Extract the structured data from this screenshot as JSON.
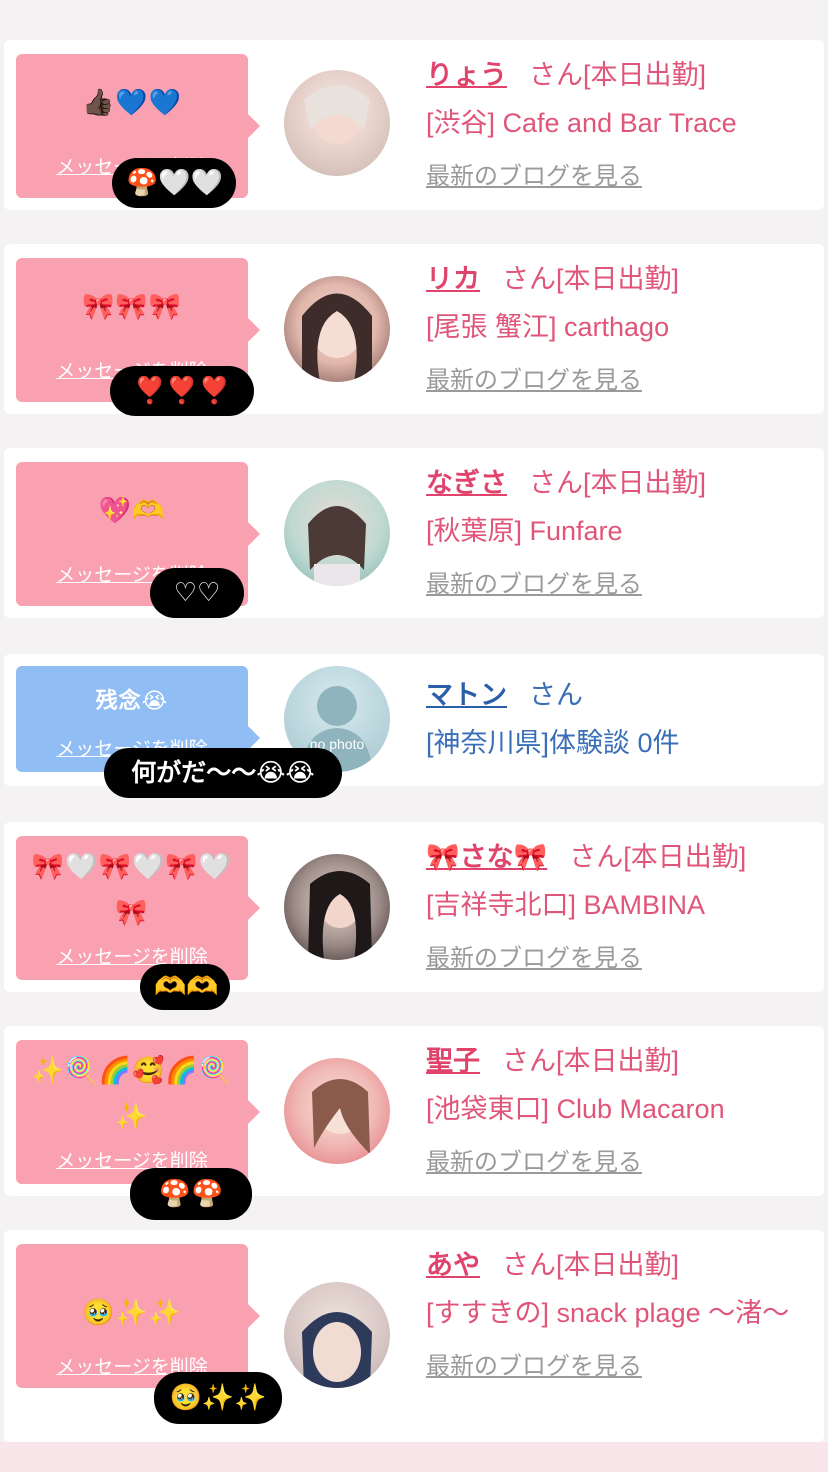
{
  "entries": [
    {
      "message": "👍🏿💙💙",
      "delete_label": "メッセージを削除",
      "reaction": "🍄🤍🤍",
      "name": "りょう",
      "suffix": "さん[本日出勤]",
      "shop": "[渋谷] Cafe and Bar Trace",
      "blog_link": "最新のブログを見る"
    },
    {
      "message": "🎀🎀🎀",
      "delete_label": "メッセージを削除",
      "reaction": "❣️❣️❣️",
      "name": "リカ",
      "suffix": "さん[本日出勤]",
      "shop": "[尾張 蟹江] carthago",
      "blog_link": "最新のブログを見る"
    },
    {
      "message": "💖🫶",
      "delete_label": "メッセージを削除",
      "reaction": "♡♡",
      "name": "なぎさ",
      "suffix": "さん[本日出勤]",
      "shop": "[秋葉原] Funfare",
      "blog_link": "最新のブログを見る"
    },
    {
      "message": "残念😭",
      "delete_label": "メッセージを削除",
      "reaction": "何がだ〜〜😭😭",
      "name": "マトン",
      "suffix": "さん",
      "shop": "[神奈川県]体験談 0件",
      "avatar_text": "no photo"
    },
    {
      "message": "🎀🤍🎀🤍🎀🤍🎀",
      "delete_label": "メッセージを削除",
      "reaction": "🫶🫶",
      "name": "🎀さな🎀",
      "suffix": "さん[本日出勤]",
      "shop": "[吉祥寺北口] BAMBINA",
      "blog_link": "最新のブログを見る"
    },
    {
      "message": "✨🍭🌈🥰🌈🍭✨",
      "delete_label": "メッセージを削除",
      "reaction": "🍄🍄",
      "name": "聖子",
      "suffix": "さん[本日出勤]",
      "shop": "[池袋東口] Club Macaron",
      "blog_link": "最新のブログを見る"
    },
    {
      "message": "🥹✨✨",
      "delete_label": "メッセージを削除",
      "reaction": "🥹✨✨",
      "name": "あや",
      "suffix": "さん[本日出勤]",
      "shop": "[すすきの] snack plage 〜渚〜",
      "blog_link": "最新のブログを見る"
    }
  ],
  "colors": {
    "pink_bubble": "#f9a1b1",
    "blue_bubble": "#90bdf4",
    "accent_pink": "#e0446c",
    "accent_blue": "#2a5fa8"
  }
}
